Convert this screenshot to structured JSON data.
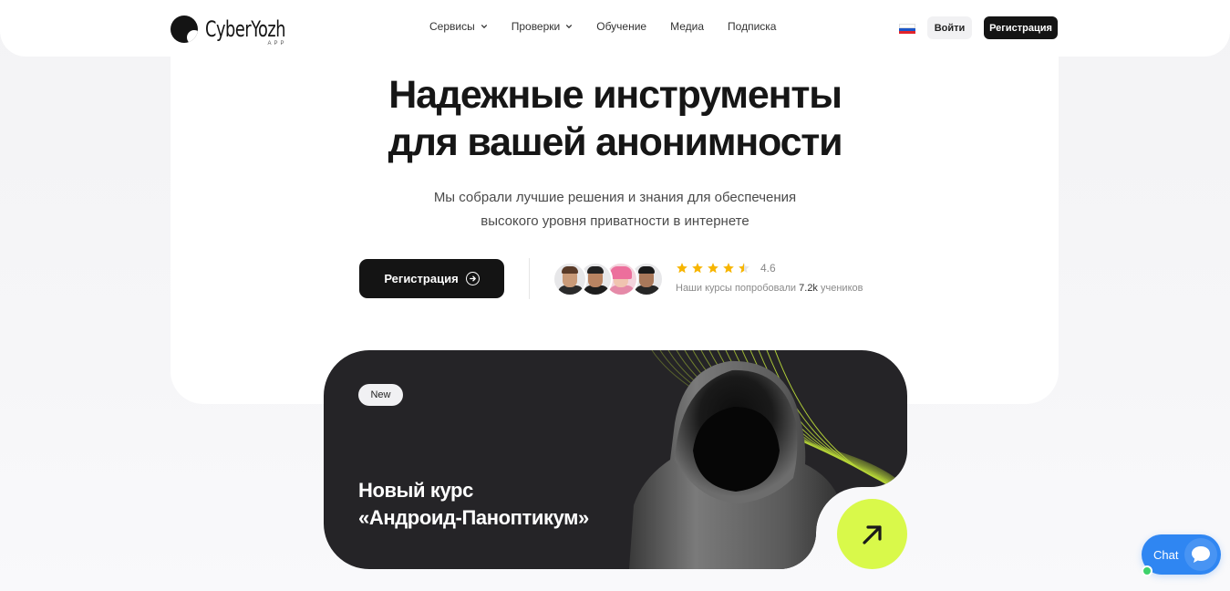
{
  "header": {
    "logo_text": "CyberYozh",
    "logo_subtext": "APP",
    "nav": [
      {
        "label": "Сервисы",
        "has_dropdown": true
      },
      {
        "label": "Проверки",
        "has_dropdown": true
      },
      {
        "label": "Обучение",
        "has_dropdown": false
      },
      {
        "label": "Медиа",
        "has_dropdown": false
      },
      {
        "label": "Подписка",
        "has_dropdown": false
      }
    ],
    "language_flag": "ru-flag-icon",
    "flag_colors": [
      "#ffffff",
      "#1c57c9",
      "#e2232a"
    ],
    "login_label": "Войти",
    "register_label": "Регистрация"
  },
  "hero": {
    "title_line1": "Надежные инструменты",
    "title_line2": "для вашей анонимности",
    "subtitle_line1": "Мы собрали лучшие решения и знания для обеспечения",
    "subtitle_line2": "высокого уровня приватности в интернете",
    "cta_label": "Регистрация",
    "rating": {
      "stars": 4.6,
      "max_stars": 5,
      "value_text": "4.6",
      "reviews_prefix": "Наши курсы попробовали",
      "reviews_count": "7.2k",
      "reviews_suffix": "учеников"
    },
    "avatars": [
      {
        "name": "avatar-1"
      },
      {
        "name": "avatar-2"
      },
      {
        "name": "avatar-3"
      },
      {
        "name": "avatar-4"
      }
    ]
  },
  "promo": {
    "badge": "New",
    "title_line1": "Новый курс",
    "title_line2": "«Андроид-Паноптикум»",
    "accent_color": "#d9f94a",
    "card_color": "#252427"
  },
  "chat": {
    "label": "Chat",
    "color": "#2f86f2",
    "status": "online"
  }
}
